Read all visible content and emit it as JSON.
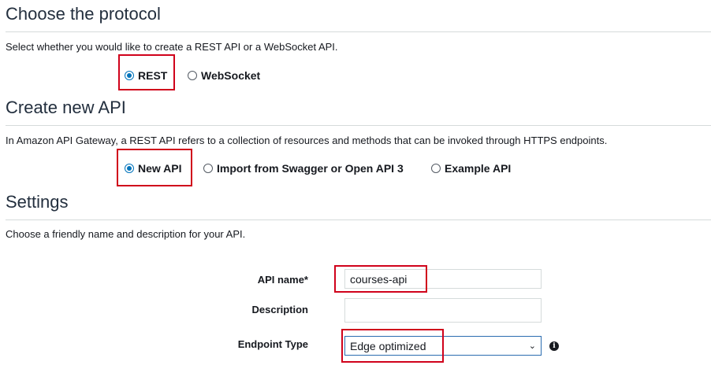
{
  "protocol": {
    "heading": "Choose the protocol",
    "description": "Select whether you would like to create a REST API or a WebSocket API.",
    "options": [
      {
        "label": "REST",
        "checked": true
      },
      {
        "label": "WebSocket",
        "checked": false
      }
    ]
  },
  "create": {
    "heading": "Create new API",
    "description": "In Amazon API Gateway, a REST API refers to a collection of resources and methods that can be invoked through HTTPS endpoints.",
    "options": [
      {
        "label": "New API",
        "checked": true
      },
      {
        "label": "Import from Swagger or Open API 3",
        "checked": false
      },
      {
        "label": "Example API",
        "checked": false
      }
    ]
  },
  "settings": {
    "heading": "Settings",
    "description": "Choose a friendly name and description for your API.",
    "api_name_label": "API name*",
    "api_name_value": "courses-api",
    "description_label": "Description",
    "description_value": "",
    "endpoint_type_label": "Endpoint Type",
    "endpoint_type_value": "Edge optimized",
    "info_icon": "info-icon"
  },
  "colors": {
    "highlight": "#d0021b",
    "radio_selected": "#0073bb"
  }
}
